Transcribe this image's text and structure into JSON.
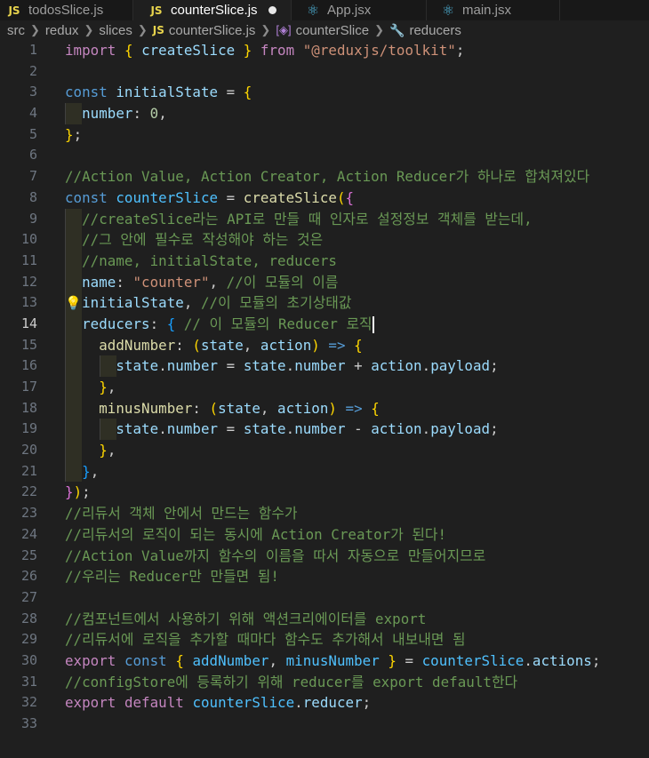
{
  "tabs": [
    {
      "name": "todosSlice.js",
      "icon": "js-file-icon",
      "active": false
    },
    {
      "name": "counterSlice.js",
      "icon": "js-file-icon",
      "active": true,
      "unsaved": true
    },
    {
      "name": "App.jsx",
      "icon": "react-file-icon",
      "active": false
    },
    {
      "name": "main.jsx",
      "icon": "react-file-icon",
      "active": false
    }
  ],
  "breadcrumb": [
    "src",
    "redux",
    "slices",
    "counterSlice.js",
    "counterSlice",
    "reducers"
  ],
  "editor": {
    "current_line": 14,
    "lines": [
      [
        [
          "kw2",
          "import"
        ],
        [
          "pn",
          " "
        ],
        [
          "br1",
          "{"
        ],
        [
          "pn",
          " "
        ],
        [
          "var",
          "createSlice"
        ],
        [
          "pn",
          " "
        ],
        [
          "br1",
          "}"
        ],
        [
          "pn",
          " "
        ],
        [
          "kw2",
          "from"
        ],
        [
          "pn",
          " "
        ],
        [
          "str",
          "\"@reduxjs/toolkit\""
        ],
        [
          "pn",
          ";"
        ]
      ],
      [],
      [
        [
          "kw",
          "const"
        ],
        [
          "pn",
          " "
        ],
        [
          "var",
          "initialState"
        ],
        [
          "pn",
          " = "
        ],
        [
          "br1",
          "{"
        ]
      ],
      [
        [
          "pn",
          "  "
        ],
        [
          "var",
          "number"
        ],
        [
          "pn",
          ": "
        ],
        [
          "num",
          "0"
        ],
        [
          "pn",
          ","
        ]
      ],
      [
        [
          "br1",
          "}"
        ],
        [
          "pn",
          ";"
        ]
      ],
      [],
      [
        [
          "cm",
          "//Action Value, Action Creator, Action Reducer가 하나로 합쳐져있다"
        ]
      ],
      [
        [
          "kw",
          "const"
        ],
        [
          "pn",
          " "
        ],
        [
          "const",
          "counterSlice"
        ],
        [
          "pn",
          " = "
        ],
        [
          "fn",
          "createSlice"
        ],
        [
          "br1",
          "("
        ],
        [
          "br2",
          "{"
        ]
      ],
      [
        [
          "pn",
          "  "
        ],
        [
          "cm",
          "//createSlice라는 API로 만들 때 인자로 설정정보 객체를 받는데,"
        ]
      ],
      [
        [
          "pn",
          "  "
        ],
        [
          "cm",
          "//그 안에 필수로 작성해야 하는 것은"
        ]
      ],
      [
        [
          "pn",
          "  "
        ],
        [
          "cm",
          "//name, initialState, reducers"
        ]
      ],
      [
        [
          "pn",
          "  "
        ],
        [
          "var",
          "name"
        ],
        [
          "pn",
          ": "
        ],
        [
          "str",
          "\"counter\""
        ],
        [
          "pn",
          ", "
        ],
        [
          "cm",
          "//이 모듈의 이름"
        ]
      ],
      [
        [
          "pn",
          "  "
        ],
        [
          "var",
          "initialState"
        ],
        [
          "pn",
          ", "
        ],
        [
          "cm",
          "//이 모듈의 초기상태값"
        ]
      ],
      [
        [
          "pn",
          "  "
        ],
        [
          "var",
          "reducers"
        ],
        [
          "pn",
          ": "
        ],
        [
          "br3",
          "{"
        ],
        [
          "pn",
          " "
        ],
        [
          "cm",
          "// 이 모듈의 Reducer 로직"
        ]
      ],
      [
        [
          "pn",
          "    "
        ],
        [
          "fn",
          "addNumber"
        ],
        [
          "pn",
          ": "
        ],
        [
          "br1",
          "("
        ],
        [
          "var",
          "state"
        ],
        [
          "pn",
          ", "
        ],
        [
          "var",
          "action"
        ],
        [
          "br1",
          ")"
        ],
        [
          "pn",
          " "
        ],
        [
          "kw",
          "=>"
        ],
        [
          "pn",
          " "
        ],
        [
          "br1",
          "{"
        ]
      ],
      [
        [
          "pn",
          "      "
        ],
        [
          "var",
          "state"
        ],
        [
          "pn",
          "."
        ],
        [
          "var",
          "number"
        ],
        [
          "pn",
          " = "
        ],
        [
          "var",
          "state"
        ],
        [
          "pn",
          "."
        ],
        [
          "var",
          "number"
        ],
        [
          "pn",
          " + "
        ],
        [
          "var",
          "action"
        ],
        [
          "pn",
          "."
        ],
        [
          "var",
          "payload"
        ],
        [
          "pn",
          ";"
        ]
      ],
      [
        [
          "pn",
          "    "
        ],
        [
          "br1",
          "}"
        ],
        [
          "pn",
          ","
        ]
      ],
      [
        [
          "pn",
          "    "
        ],
        [
          "fn",
          "minusNumber"
        ],
        [
          "pn",
          ": "
        ],
        [
          "br1",
          "("
        ],
        [
          "var",
          "state"
        ],
        [
          "pn",
          ", "
        ],
        [
          "var",
          "action"
        ],
        [
          "br1",
          ")"
        ],
        [
          "pn",
          " "
        ],
        [
          "kw",
          "=>"
        ],
        [
          "pn",
          " "
        ],
        [
          "br1",
          "{"
        ]
      ],
      [
        [
          "pn",
          "      "
        ],
        [
          "var",
          "state"
        ],
        [
          "pn",
          "."
        ],
        [
          "var",
          "number"
        ],
        [
          "pn",
          " = "
        ],
        [
          "var",
          "state"
        ],
        [
          "pn",
          "."
        ],
        [
          "var",
          "number"
        ],
        [
          "pn",
          " - "
        ],
        [
          "var",
          "action"
        ],
        [
          "pn",
          "."
        ],
        [
          "var",
          "payload"
        ],
        [
          "pn",
          ";"
        ]
      ],
      [
        [
          "pn",
          "    "
        ],
        [
          "br1",
          "}"
        ],
        [
          "pn",
          ","
        ]
      ],
      [
        [
          "pn",
          "  "
        ],
        [
          "br3",
          "}"
        ],
        [
          "pn",
          ","
        ]
      ],
      [
        [
          "br2",
          "}"
        ],
        [
          "br1",
          ")"
        ],
        [
          "pn",
          ";"
        ]
      ],
      [
        [
          "cm",
          "//리듀서 객체 안에서 만드는 함수가"
        ]
      ],
      [
        [
          "cm",
          "//리듀서의 로직이 되는 동시에 Action Creator가 된다!"
        ]
      ],
      [
        [
          "cm",
          "//Action Value까지 함수의 이름을 따서 자동으로 만들어지므로"
        ]
      ],
      [
        [
          "cm",
          "//우리는 Reducer만 만들면 됨!"
        ]
      ],
      [],
      [
        [
          "cm",
          "//컴포넌트에서 사용하기 위해 액션크리에이터를 export"
        ]
      ],
      [
        [
          "cm",
          "//리듀서에 로직을 추가할 때마다 함수도 추가해서 내보내면 됨"
        ]
      ],
      [
        [
          "kw2",
          "export"
        ],
        [
          "pn",
          " "
        ],
        [
          "kw",
          "const"
        ],
        [
          "pn",
          " "
        ],
        [
          "br1",
          "{"
        ],
        [
          "pn",
          " "
        ],
        [
          "const",
          "addNumber"
        ],
        [
          "pn",
          ", "
        ],
        [
          "const",
          "minusNumber"
        ],
        [
          "pn",
          " "
        ],
        [
          "br1",
          "}"
        ],
        [
          "pn",
          " = "
        ],
        [
          "const",
          "counterSlice"
        ],
        [
          "pn",
          "."
        ],
        [
          "var",
          "actions"
        ],
        [
          "pn",
          ";"
        ]
      ],
      [
        [
          "cm",
          "//configStore에 등록하기 위해 reducer를 export default한다"
        ]
      ],
      [
        [
          "kw2",
          "export"
        ],
        [
          "pn",
          " "
        ],
        [
          "kw2",
          "default"
        ],
        [
          "pn",
          " "
        ],
        [
          "const",
          "counterSlice"
        ],
        [
          "pn",
          "."
        ],
        [
          "var",
          "reducer"
        ],
        [
          "pn",
          ";"
        ]
      ],
      []
    ]
  }
}
